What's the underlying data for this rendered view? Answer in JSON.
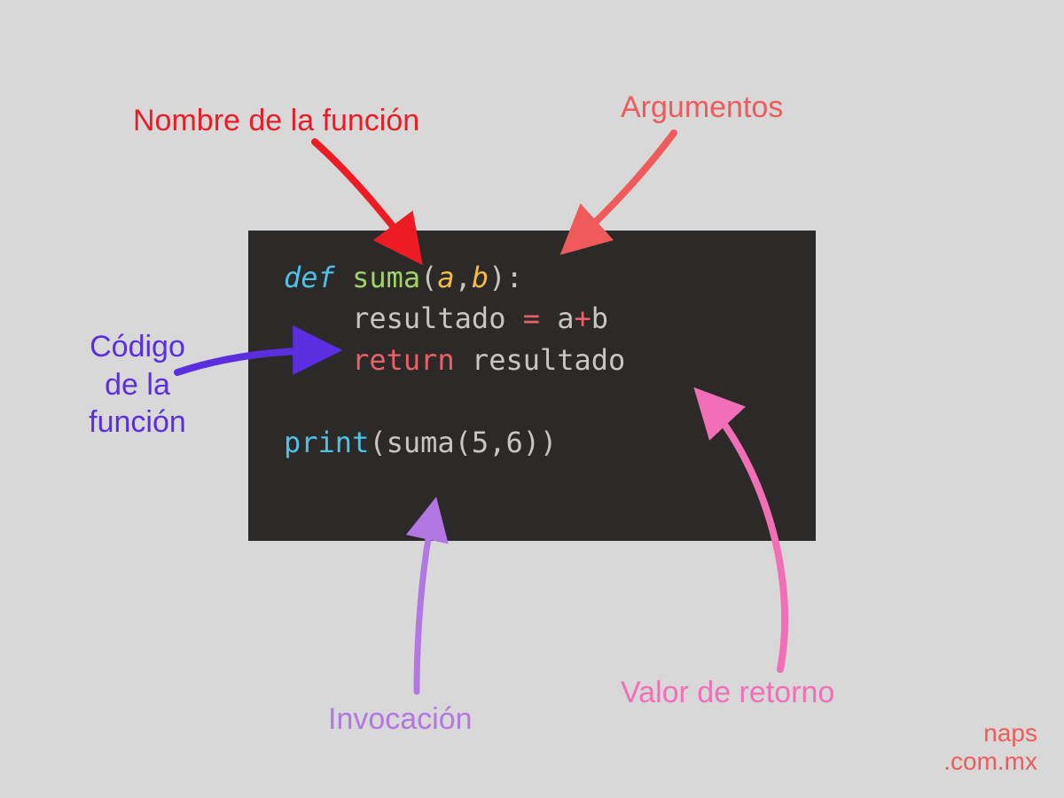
{
  "labels": {
    "function_name": "Nombre de la función",
    "arguments": "Argumentos",
    "function_body": "Código\nde la\nfunción",
    "invocation": "Invocación",
    "return_value": "Valor de retorno"
  },
  "code": {
    "keyword_def": "def",
    "func_name": "suma",
    "params": [
      "a",
      "b"
    ],
    "body_var": "resultado",
    "body_expr_lhs": "a",
    "body_expr_op": "+",
    "body_expr_rhs": "b",
    "keyword_return": "return",
    "return_var": "resultado",
    "call_print": "print",
    "call_func": "suma",
    "call_args": [
      "5",
      "6"
    ]
  },
  "watermark": {
    "line1": "naps",
    "line2": ".com.mx"
  },
  "colors": {
    "red": "#ed1c24",
    "salmon": "#ef5b5b",
    "purple": "#5b2ee0",
    "lavender": "#b377e3",
    "pink": "#f26fb7",
    "code_bg": "#2b2a28"
  }
}
